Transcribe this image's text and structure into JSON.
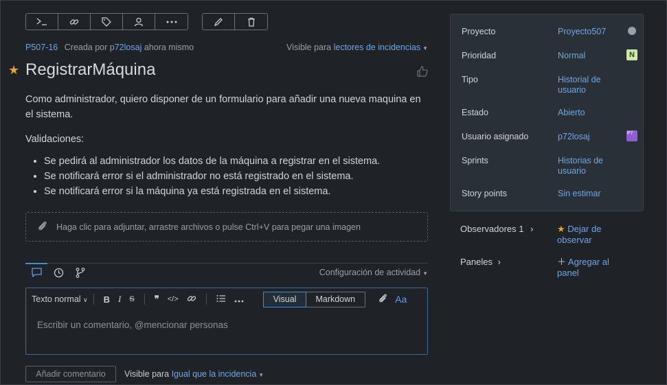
{
  "toolbar": {
    "group1": [
      "terminal-icon",
      "link-icon",
      "tag-icon",
      "user-icon",
      "more-icon"
    ],
    "group2": [
      "pencil-icon",
      "trash-icon"
    ]
  },
  "meta": {
    "issue_id": "P507-16",
    "created_by_label": "Creada por",
    "creator": "p72losaj",
    "time": "ahora mismo",
    "visible_label": "Visible para",
    "visible_value": "lectores de incidencias"
  },
  "title": "RegistrarMáquina",
  "description": {
    "paragraph1": "Como administrador, quiero disponer de un formulario para añadir una nueva maquina en el sistema.",
    "paragraph2": "Validaciones:",
    "bullets": [
      "Se pedirá al administrador los datos de la máquina a registrar en el sistema.",
      "Se notificará error si el administrador no está registrado en el sistema.",
      "Se notificará error si la máquina ya está registrada en el sistema."
    ]
  },
  "attach": {
    "text": "Haga clic para adjuntar, arrastre archivos o pulse Ctrl+V para pegar una imagen"
  },
  "activity": {
    "config_label": "Configuración de actividad"
  },
  "editor": {
    "text_style": "Texto normal",
    "mode_visual": "Visual",
    "mode_markdown": "Markdown",
    "aa": "Aa",
    "placeholder": "Escribir un comentario, @mencionar personas"
  },
  "footer": {
    "add_comment": "Añadir comentario",
    "visible_label": "Visible para",
    "visible_value": "Igual que la incidencia"
  },
  "properties": {
    "project_label": "Proyecto",
    "project_value": "Proyecto507",
    "priority_label": "Prioridad",
    "priority_value": "Normal",
    "priority_badge": "N",
    "type_label": "Tipo",
    "type_value": "Historial de usuario",
    "state_label": "Estado",
    "state_value": "Abierto",
    "assignee_label": "Usuario asignado",
    "assignee_value": "p72losaj",
    "assignee_avatar": "P7",
    "sprints_label": "Sprints",
    "sprints_value": "Historias de usuario",
    "points_label": "Story points",
    "points_value": "Sin estimar"
  },
  "side": {
    "watchers_label": "Observadores",
    "watchers_count": "1",
    "stop_watching": "Dejar de observar",
    "boards_label": "Paneles",
    "add_board": "Agregar al panel"
  },
  "colors": {
    "accent": "#6fa8e6",
    "star": "#e5a62b",
    "background": "#1f2226",
    "panel": "#2a3038"
  }
}
